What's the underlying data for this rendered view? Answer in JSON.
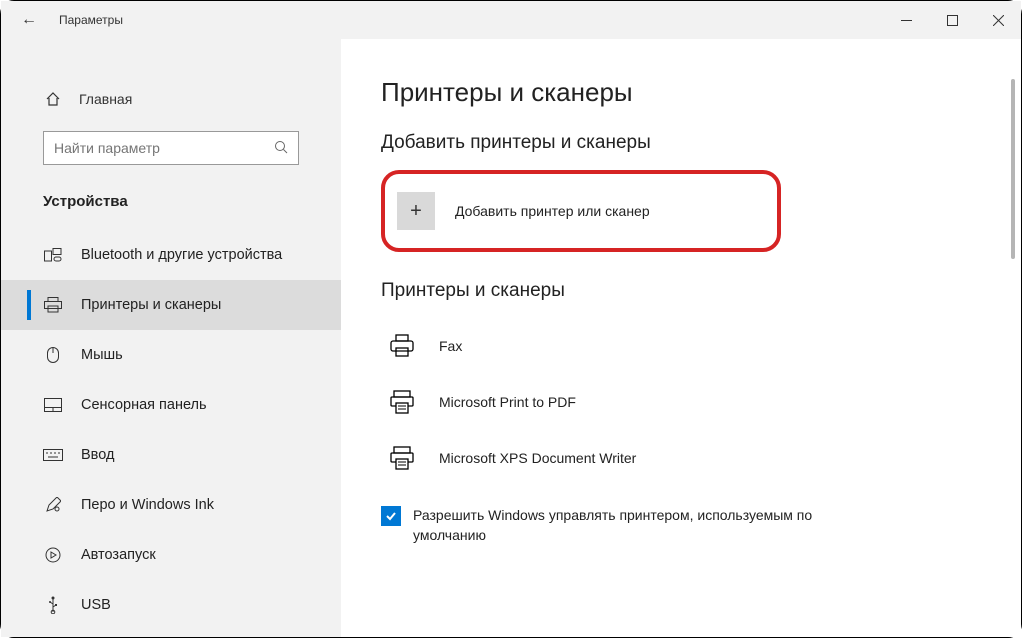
{
  "titlebar": {
    "title": "Параметры"
  },
  "home": {
    "label": "Главная"
  },
  "search": {
    "placeholder": "Найти параметр"
  },
  "category": {
    "title": "Устройства"
  },
  "nav": [
    {
      "id": "bluetooth",
      "label": "Bluetooth и другие устройства",
      "icon": "bluetooth-devices"
    },
    {
      "id": "printers",
      "label": "Принтеры и сканеры",
      "icon": "printer"
    },
    {
      "id": "mouse",
      "label": "Мышь",
      "icon": "mouse"
    },
    {
      "id": "touchpad",
      "label": "Сенсорная панель",
      "icon": "touchpad"
    },
    {
      "id": "typing",
      "label": "Ввод",
      "icon": "keyboard"
    },
    {
      "id": "pen",
      "label": "Перо и Windows Ink",
      "icon": "pen"
    },
    {
      "id": "autoplay",
      "label": "Автозапуск",
      "icon": "autoplay"
    },
    {
      "id": "usb",
      "label": "USB",
      "icon": "usb"
    }
  ],
  "page": {
    "title": "Принтеры и сканеры",
    "section_add_title": "Добавить принтеры и сканеры",
    "add_button_label": "Добавить принтер или сканер",
    "section_list_title": "Принтеры и сканеры",
    "printers": [
      {
        "label": "Fax",
        "icon": "fax"
      },
      {
        "label": "Microsoft Print to PDF",
        "icon": "print-to-file"
      },
      {
        "label": "Microsoft XPS Document Writer",
        "icon": "print-to-file"
      }
    ],
    "default_checkbox_label": "Разрешить Windows управлять принтером, используемым по умолчанию",
    "default_checkbox_checked": true
  }
}
